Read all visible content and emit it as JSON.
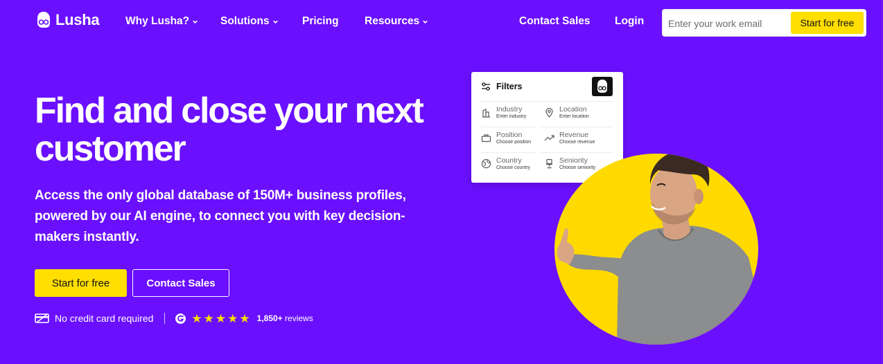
{
  "brand": {
    "name": "Lusha"
  },
  "nav": {
    "items": [
      {
        "label": "Why Lusha?",
        "has_dropdown": true
      },
      {
        "label": "Solutions",
        "has_dropdown": true
      },
      {
        "label": "Pricing",
        "has_dropdown": false
      },
      {
        "label": "Resources",
        "has_dropdown": true
      }
    ],
    "contact_sales": "Contact Sales",
    "login": "Login",
    "email_placeholder": "Enter your work email",
    "cta": "Start for free"
  },
  "hero": {
    "headline": "Find and close your next customer",
    "subtext": "Access the only global database of 150M+ business profiles, powered by our AI engine, to connect you with key decision-makers instantly.",
    "primary_cta": "Start for free",
    "secondary_cta": "Contact Sales",
    "no_card": "No credit card required",
    "rating_stars": 5,
    "review_count": "1,850+",
    "review_label": "reviews"
  },
  "filter_card": {
    "title": "Filters",
    "filters": [
      {
        "name": "Industry",
        "hint": "Enter industry",
        "icon": "building-icon"
      },
      {
        "name": "Location",
        "hint": "Enter location",
        "icon": "location-pin-icon"
      },
      {
        "name": "Position",
        "hint": "Choose position",
        "icon": "briefcase-icon"
      },
      {
        "name": "Revenue",
        "hint": "Choose revenue",
        "icon": "trend-up-icon"
      },
      {
        "name": "Country",
        "hint": "Choose country",
        "icon": "globe-icon"
      },
      {
        "name": "Seniority",
        "hint": "Choose seniority",
        "icon": "chair-icon"
      }
    ]
  },
  "colors": {
    "background": "#6a10ff",
    "accent_yellow": "#ffde00",
    "text_on_bg": "#ffffff"
  }
}
